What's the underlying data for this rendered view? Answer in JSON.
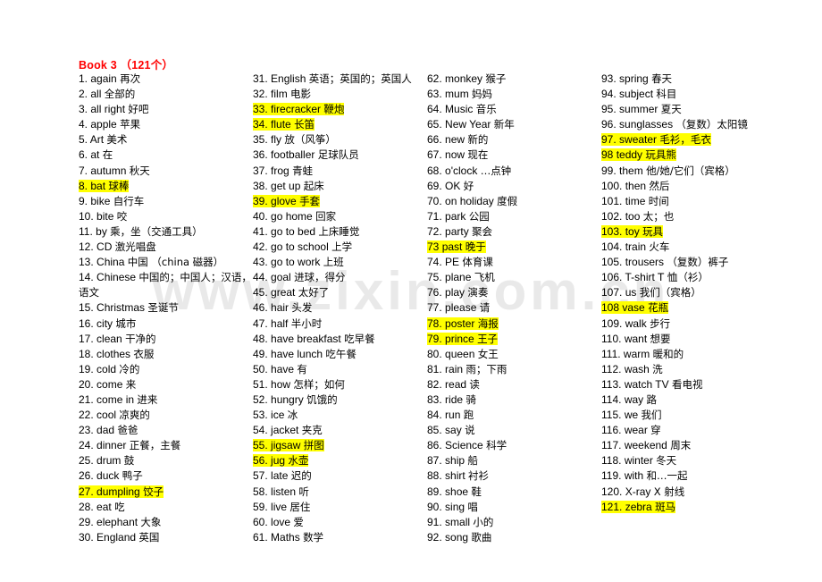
{
  "document": {
    "title": "Book 3 （121个）",
    "title_color": "#ff0000",
    "highlight_color": "#ffff00",
    "watermark": "www.zixin.com.cn"
  },
  "columns": [
    {
      "id": "col-1",
      "entries": [
        {
          "num": "1.",
          "word": "again",
          "zh": "再次",
          "highlight": false
        },
        {
          "num": "2.",
          "word": "all",
          "zh": "全部的",
          "highlight": false
        },
        {
          "num": "3.",
          "word": "all right",
          "zh": "好吧",
          "highlight": false
        },
        {
          "num": "4.",
          "word": "apple",
          "zh": "苹果",
          "highlight": false
        },
        {
          "num": "5.",
          "word": "Art",
          "zh": "美术",
          "highlight": false
        },
        {
          "num": "6.",
          "word": "at",
          "zh": "在",
          "highlight": false
        },
        {
          "num": "7.",
          "word": "autumn",
          "zh": "秋天",
          "highlight": false
        },
        {
          "num": "8.",
          "word": "bat",
          "zh": "球棒",
          "highlight": true
        },
        {
          "num": "9.",
          "word": "bike",
          "zh": "自行车",
          "highlight": false
        },
        {
          "num": "10.",
          "word": "bite",
          "zh": "咬",
          "highlight": false
        },
        {
          "num": "11.",
          "word": "by",
          "zh": "乘，坐（交通工具）",
          "highlight": false
        },
        {
          "num": "12.",
          "word": "CD",
          "zh": "激光唱盘",
          "highlight": false
        },
        {
          "num": "13.",
          "word": "China",
          "zh": "中国 （china 磁器）",
          "highlight": false
        },
        {
          "num": "14.",
          "word": "Chinese",
          "zh": "中国的；中国人；汉语，语文",
          "highlight": false
        },
        {
          "num": "15.",
          "word": "Christmas",
          "zh": "圣诞节",
          "highlight": false
        },
        {
          "num": "16.",
          "word": "city",
          "zh": "城市",
          "highlight": false
        },
        {
          "num": "17.",
          "word": "clean",
          "zh": "干净的",
          "highlight": false
        },
        {
          "num": "18.",
          "word": "clothes",
          "zh": "衣服",
          "highlight": false
        },
        {
          "num": "19.",
          "word": "cold",
          "zh": "冷的",
          "highlight": false
        },
        {
          "num": "20.",
          "word": "come",
          "zh": "来",
          "highlight": false
        },
        {
          "num": "21.",
          "word": "come in",
          "zh": "进来",
          "highlight": false
        },
        {
          "num": "22.",
          "word": "cool",
          "zh": "凉爽的",
          "highlight": false
        },
        {
          "num": "23.",
          "word": "dad",
          "zh": "爸爸",
          "highlight": false
        },
        {
          "num": "24.",
          "word": "dinner",
          "zh": "正餐，主餐",
          "highlight": false
        },
        {
          "num": "25.",
          "word": "drum",
          "zh": "鼓",
          "highlight": false
        },
        {
          "num": "26.",
          "word": "duck",
          "zh": "鸭子",
          "highlight": false
        },
        {
          "num": "27.",
          "word": "dumpling",
          "zh": "饺子",
          "highlight": true
        },
        {
          "num": "28.",
          "word": "eat",
          "zh": "吃",
          "highlight": false
        },
        {
          "num": "29.",
          "word": "elephant",
          "zh": "大象",
          "highlight": false
        },
        {
          "num": "30.",
          "word": "England",
          "zh": "英国",
          "highlight": false
        }
      ]
    },
    {
      "id": "col-2",
      "entries": [
        {
          "num": "31.",
          "word": "English",
          "zh": "英语；英国的；英国人",
          "highlight": false
        },
        {
          "num": "32.",
          "word": "film",
          "zh": "电影",
          "highlight": false
        },
        {
          "num": "33.",
          "word": "firecracker",
          "zh": "鞭炮",
          "highlight": true
        },
        {
          "num": "34.",
          "word": "flute",
          "zh": "长笛",
          "highlight": true
        },
        {
          "num": "35.",
          "word": "fly",
          "zh": "放（风筝）",
          "highlight": false
        },
        {
          "num": "36.",
          "word": "footballer",
          "zh": "足球队员",
          "highlight": false
        },
        {
          "num": "37.",
          "word": "frog",
          "zh": "青蛙",
          "highlight": false
        },
        {
          "num": "38.",
          "word": "get up",
          "zh": "起床",
          "highlight": false
        },
        {
          "num": "39.",
          "word": "glove",
          "zh": "手套",
          "highlight": true
        },
        {
          "num": "40.",
          "word": "go home",
          "zh": "回家",
          "highlight": false
        },
        {
          "num": "41.",
          "word": "go to bed",
          "zh": "上床睡觉",
          "highlight": false
        },
        {
          "num": "42.",
          "word": "go to school",
          "zh": "上学",
          "highlight": false
        },
        {
          "num": "43.",
          "word": "go to work",
          "zh": "上班",
          "highlight": false
        },
        {
          "num": "44.",
          "word": "goal",
          "zh": "进球，得分",
          "highlight": false
        },
        {
          "num": "45.",
          "word": "great",
          "zh": "太好了",
          "highlight": false
        },
        {
          "num": "46.",
          "word": "hair",
          "zh": "头发",
          "highlight": false
        },
        {
          "num": "47.",
          "word": "half",
          "zh": "半小时",
          "highlight": false
        },
        {
          "num": "48.",
          "word": "have breakfast",
          "zh": "吃早餐",
          "highlight": false
        },
        {
          "num": "49.",
          "word": "have lunch",
          "zh": "吃午餐",
          "highlight": false
        },
        {
          "num": "50.",
          "word": "have",
          "zh": "有",
          "highlight": false
        },
        {
          "num": "51.",
          "word": "how",
          "zh": "怎样；如何",
          "highlight": false
        },
        {
          "num": "52.",
          "word": "hungry",
          "zh": "饥饿的",
          "highlight": false
        },
        {
          "num": "53.",
          "word": "ice",
          "zh": "冰",
          "highlight": false
        },
        {
          "num": "54.",
          "word": "jacket",
          "zh": "夹克",
          "highlight": false
        },
        {
          "num": "55.",
          "word": "jigsaw",
          "zh": "拼图",
          "highlight": true
        },
        {
          "num": "56.",
          "word": "jug",
          "zh": "水壶",
          "highlight": true
        },
        {
          "num": "57.",
          "word": "late",
          "zh": "迟的",
          "highlight": false
        },
        {
          "num": "58.",
          "word": "listen",
          "zh": "听",
          "highlight": false
        },
        {
          "num": "59.",
          "word": "live",
          "zh": "居住",
          "highlight": false
        },
        {
          "num": "60.",
          "word": "love",
          "zh": "爱",
          "highlight": false
        },
        {
          "num": "61.",
          "word": "Maths",
          "zh": "数学",
          "highlight": false
        }
      ]
    },
    {
      "id": "col-3",
      "entries": [
        {
          "num": "62.",
          "word": "monkey",
          "zh": "猴子",
          "highlight": false
        },
        {
          "num": "63.",
          "word": "mum",
          "zh": "妈妈",
          "highlight": false
        },
        {
          "num": "64.",
          "word": "Music",
          "zh": "音乐",
          "highlight": false
        },
        {
          "num": "65.",
          "word": "New Year",
          "zh": "新年",
          "highlight": false
        },
        {
          "num": "66.",
          "word": "new",
          "zh": "新的",
          "highlight": false
        },
        {
          "num": "67.",
          "word": "now",
          "zh": "现在",
          "highlight": false
        },
        {
          "num": "68.",
          "word": "o'clock",
          "zh": "…点钟",
          "highlight": false
        },
        {
          "num": "69.",
          "word": "OK",
          "zh": "好",
          "highlight": false
        },
        {
          "num": "70.",
          "word": "on holiday",
          "zh": "度假",
          "highlight": false
        },
        {
          "num": "71.",
          "word": "park",
          "zh": "公园",
          "highlight": false
        },
        {
          "num": "72.",
          "word": "party",
          "zh": "聚会",
          "highlight": false
        },
        {
          "num": "73",
          "word": "past",
          "zh": "晚于",
          "highlight": true
        },
        {
          "num": "74.",
          "word": "PE",
          "zh": "体育课",
          "highlight": false
        },
        {
          "num": "75.",
          "word": "plane",
          "zh": "飞机",
          "highlight": false
        },
        {
          "num": "76.",
          "word": "play",
          "zh": "演奏",
          "highlight": false
        },
        {
          "num": "77.",
          "word": "please",
          "zh": "请",
          "highlight": false
        },
        {
          "num": "78.",
          "word": "poster",
          "zh": "海报",
          "highlight": true
        },
        {
          "num": "79.",
          "word": "prince",
          "zh": "王子",
          "highlight": true
        },
        {
          "num": "80.",
          "word": "queen",
          "zh": "女王",
          "highlight": false
        },
        {
          "num": "81.",
          "word": "rain",
          "zh": "雨；下雨",
          "highlight": false
        },
        {
          "num": "82.",
          "word": "read",
          "zh": "读",
          "highlight": false
        },
        {
          "num": "83.",
          "word": "ride",
          "zh": "骑",
          "highlight": false
        },
        {
          "num": "84.",
          "word": "run",
          "zh": "跑",
          "highlight": false
        },
        {
          "num": "85.",
          "word": "say",
          "zh": "说",
          "highlight": false
        },
        {
          "num": "86.",
          "word": "Science",
          "zh": "科学",
          "highlight": false
        },
        {
          "num": "87.",
          "word": "ship",
          "zh": "船",
          "highlight": false
        },
        {
          "num": "88.",
          "word": "shirt",
          "zh": "衬衫",
          "highlight": false
        },
        {
          "num": "89.",
          "word": "shoe",
          "zh": "鞋",
          "highlight": false
        },
        {
          "num": "90.",
          "word": "sing",
          "zh": "唱",
          "highlight": false
        },
        {
          "num": "91.",
          "word": "small",
          "zh": "小的",
          "highlight": false
        },
        {
          "num": "92.",
          "word": "song",
          "zh": "歌曲",
          "highlight": false
        }
      ]
    },
    {
      "id": "col-4",
      "entries": [
        {
          "num": "93.",
          "word": "spring",
          "zh": "春天",
          "highlight": false
        },
        {
          "num": "94.",
          "word": "subject",
          "zh": "科目",
          "highlight": false
        },
        {
          "num": "95.",
          "word": "summer",
          "zh": "夏天",
          "highlight": false
        },
        {
          "num": "96.",
          "word": "sunglasses",
          "zh": "（复数）太阳镜",
          "highlight": false
        },
        {
          "num": "97.",
          "word": "sweater",
          "zh": "毛衫，毛衣",
          "highlight": true
        },
        {
          "num": "98",
          "word": "teddy",
          "zh": "玩具熊",
          "highlight": true
        },
        {
          "num": "99.",
          "word": "them",
          "zh": "他/她/它们（宾格）",
          "highlight": false
        },
        {
          "num": "100.",
          "word": "then",
          "zh": "然后",
          "highlight": false
        },
        {
          "num": "101.",
          "word": "time",
          "zh": "时间",
          "highlight": false
        },
        {
          "num": "102.",
          "word": "too",
          "zh": "太；也",
          "highlight": false
        },
        {
          "num": "103.",
          "word": "toy",
          "zh": "玩具",
          "highlight": true
        },
        {
          "num": "104.",
          "word": "train",
          "zh": "火车",
          "highlight": false
        },
        {
          "num": "105.",
          "word": "trousers",
          "zh": "（复数）裤子",
          "highlight": false
        },
        {
          "num": "106.",
          "word": "T-shirt",
          "zh": "T 恤（衫）",
          "highlight": false
        },
        {
          "num": "107.",
          "word": "us",
          "zh": "我们（宾格）",
          "highlight": false
        },
        {
          "num": "108",
          "word": "vase",
          "zh": "花瓶",
          "highlight": true
        },
        {
          "num": "109.",
          "word": "walk",
          "zh": "步行",
          "highlight": false
        },
        {
          "num": "110.",
          "word": "want",
          "zh": "想要",
          "highlight": false
        },
        {
          "num": "111.",
          "word": "warm",
          "zh": "暖和的",
          "highlight": false
        },
        {
          "num": "112.",
          "word": "wash",
          "zh": "洗",
          "highlight": false
        },
        {
          "num": "113.",
          "word": "watch TV",
          "zh": "看电视",
          "highlight": false
        },
        {
          "num": "114.",
          "word": "way",
          "zh": "路",
          "highlight": false
        },
        {
          "num": "115.",
          "word": "we",
          "zh": "我们",
          "highlight": false
        },
        {
          "num": "116.",
          "word": "wear",
          "zh": "穿",
          "highlight": false
        },
        {
          "num": "117.",
          "word": "weekend",
          "zh": "周末",
          "highlight": false
        },
        {
          "num": "118.",
          "word": "winter",
          "zh": "冬天",
          "highlight": false
        },
        {
          "num": "119.",
          "word": "with",
          "zh": "和…一起",
          "highlight": false
        },
        {
          "num": "120.",
          "word": "X-ray",
          "zh": "X 射线",
          "highlight": false
        },
        {
          "num": "121.",
          "word": "zebra",
          "zh": "斑马",
          "highlight": true
        }
      ]
    }
  ]
}
